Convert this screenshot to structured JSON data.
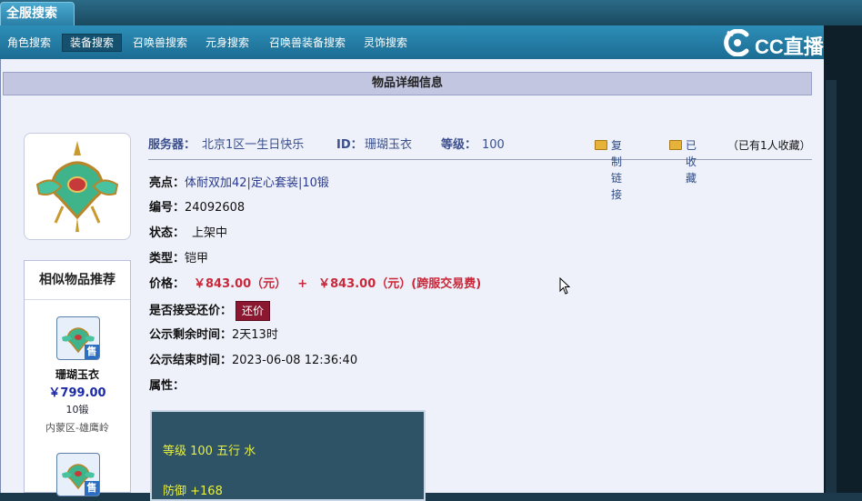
{
  "top_tab": {
    "label": "全服搜索"
  },
  "nav": {
    "items": [
      {
        "label": "角色搜索",
        "active": false
      },
      {
        "label": "装备搜索",
        "active": true
      },
      {
        "label": "召唤兽搜索",
        "active": false
      },
      {
        "label": "元身搜索",
        "active": false
      },
      {
        "label": "召唤兽装备搜索",
        "active": false
      },
      {
        "label": "灵饰搜索",
        "active": false
      }
    ]
  },
  "logo": {
    "text": "CC直播"
  },
  "panel": {
    "title": "物品详细信息"
  },
  "similar": {
    "title": "相似物品推荐",
    "items": [
      {
        "name": "珊瑚玉衣",
        "price": "￥799.00",
        "forge": "10锻",
        "server": "内蒙区-雄鹰岭",
        "badge": "售"
      },
      {
        "badge": "售"
      }
    ]
  },
  "header": {
    "server_label": "服务器：",
    "server": "北京1区一生日快乐",
    "id_label": "ID：",
    "id": "珊瑚玉衣",
    "level_label": "等级：",
    "level": "100",
    "copy_link": "复制链接",
    "favorited": "已收藏",
    "fav_count": "（已有1人收藏）"
  },
  "details": {
    "highlights_label": "亮点：",
    "highlights": "体耐双加42|定心套装|10锻",
    "number_label": "编号：",
    "number": "24092608",
    "status_label": "状态：",
    "status": "上架中",
    "type_label": "类型：",
    "type": "铠甲",
    "price_label": "价格：",
    "price": "￥843.00（元）",
    "price_plus": "+",
    "price_fee": "￥843.00（元）(跨服交易费)",
    "counter_label": "是否接受还价：",
    "counter_button": "还价",
    "remain_label": "公示剩余时间：",
    "remain": "2天13时",
    "end_label": "公示结束时间：",
    "end": "2023-06-08 12:36:40",
    "attr_label": "属性："
  },
  "attributes": {
    "lines": [
      "等级 100 五行 水",
      "防御 +168"
    ]
  },
  "colors": {
    "nav": "#1c6c93",
    "price": "#c8283a",
    "accent_blue": "#2a3a8c",
    "attr_text": "#e8f040"
  }
}
